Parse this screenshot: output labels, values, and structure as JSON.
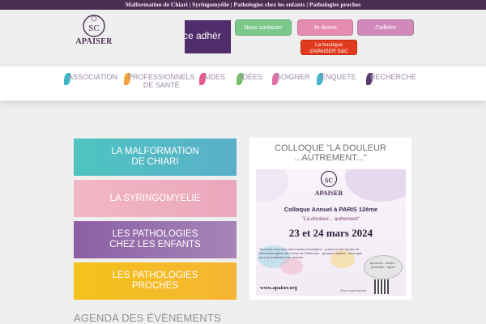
{
  "topbar": {
    "text": "Malformation de Chiari | Syringomyélie | Pathologies chez les enfants | Pathologies proches"
  },
  "logo": {
    "text": "APAISER"
  },
  "banner": {
    "text": "ce adhér"
  },
  "buttons": {
    "contact": "Nous contacter",
    "donate": "Je donne",
    "join": "J'adhère",
    "shop_line1": "La boutique",
    "shop_line2": "d'APAISER S&C"
  },
  "nav": {
    "items": [
      {
        "label": "ASSOCIATION",
        "color": "#3fb7c9"
      },
      {
        "label_l1": "PROFESSIONNELS",
        "label_l2": "DE SANTÉ",
        "color": "#f2a23c"
      },
      {
        "label": "AIDES",
        "color": "#e8578f"
      },
      {
        "label": "IDÉES",
        "color": "#77c06a"
      },
      {
        "label": "SOIGNER",
        "color": "#e26fa8"
      },
      {
        "label": "ENQUETE",
        "color": "#46b6c9"
      },
      {
        "label": "RECHERCHE",
        "color": "#5b3b6e"
      }
    ]
  },
  "tiles": {
    "chiari_l1": "LA MALFORMATION",
    "chiari_l2": "DE CHIARI",
    "syringo": "LA SYRINGOMYELIE",
    "enfants_l1": "LES PATHOLOGIES",
    "enfants_l2": "CHEZ LES ENFANTS",
    "proches_l1": "LES PATHOLOGIES",
    "proches_l2": "PROCHES"
  },
  "agenda": {
    "title": "AGENDA DES ÉVÈNEMENTS"
  },
  "colloque": {
    "title_l1": "COLLOQUE \"LA DOULEUR",
    "title_l2": "...AUTREMENT...\"",
    "poster": {
      "logo": "APAISER",
      "line1": "Colloque Annuel à PARIS 12ème",
      "line2": "\"La douleur... autrement\"",
      "dates": "23 et 24 mars 2024",
      "cloud": "Journées avec des intervenants d'exception · présence de l'équipe de Neurochirurgiens du Centre de Référence · groupes ateliers · échanges pour les patients et les aidants",
      "disc": "approches · douleur · prévention · dignité",
      "website": "www.apaiser.org",
      "signup": "Pour vous inscrire"
    }
  }
}
